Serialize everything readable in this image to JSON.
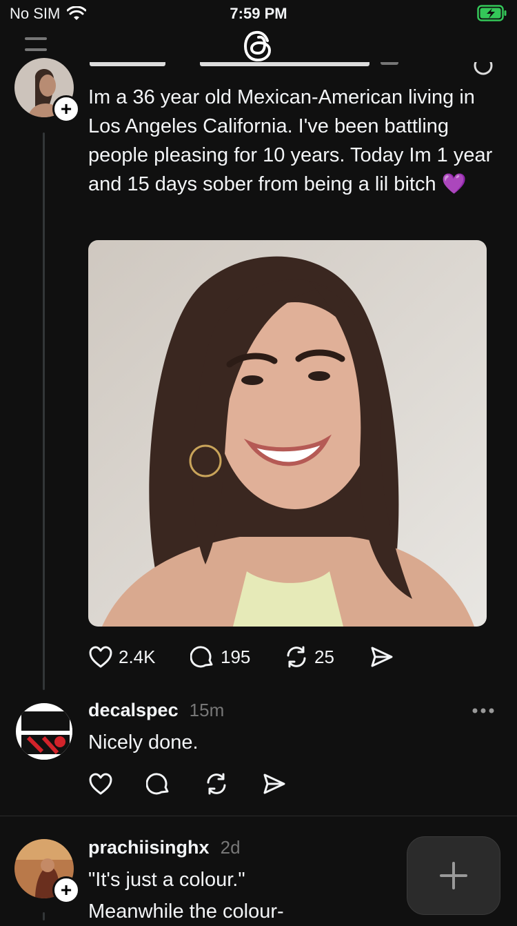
{
  "status_bar": {
    "carrier": "No SIM",
    "time": "7:59 PM"
  },
  "post1": {
    "body": "Im a 36 year old Mexican-American living in Los Angeles California. I've been battling people pleasing for 10 years. Today Im 1 year and 15 days sober from being a lil bitch 💜",
    "likes": "2.4K",
    "replies": "195",
    "reposts": "25"
  },
  "reply1": {
    "username": "decalspec",
    "time": "15m",
    "body": "Nicely done."
  },
  "post2": {
    "username": "prachiisinghx",
    "time": "2d",
    "line1": "\"It's just a colour.\"",
    "line2": "Meanwhile the colour-"
  },
  "colors": {
    "background": "#101010",
    "text": "#f3f5f7",
    "muted": "#777777",
    "battery": "#34c759",
    "heart_emoji": "#a64dff"
  }
}
